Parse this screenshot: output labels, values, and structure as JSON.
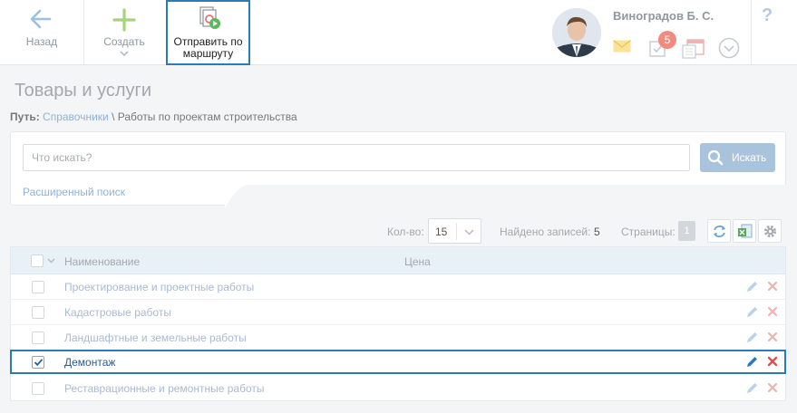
{
  "toolbar": {
    "back_label": "Назад",
    "create_label": "Создать",
    "route_label_line1": "Отправить по",
    "route_label_line2": "маршруту",
    "user_name": "Виноградов Б. С.",
    "tasks_badge": "5",
    "help_glyph": "?"
  },
  "page": {
    "title": "Товары и услуги",
    "path_label": "Путь:",
    "path_link": "Справочники",
    "path_rest": " \\ Работы по проектам строительства"
  },
  "search": {
    "placeholder": "Что искать?",
    "button_label": "Искать",
    "advanced_link": "Расширенный поиск"
  },
  "list_controls": {
    "qty_label": "Кол-во:",
    "qty_value": "15",
    "found_label": "Найдено записей:",
    "found_value": "5",
    "pages_label": "Страницы:",
    "pages_value": "1"
  },
  "table": {
    "columns": [
      "Наименование",
      "Цена"
    ],
    "rows": [
      {
        "name": "Проектирование и проектные работы",
        "checked": false
      },
      {
        "name": "Кадастровые работы",
        "checked": false
      },
      {
        "name": "Ландшафтные и земельные работы",
        "checked": false
      },
      {
        "name": "Демонтаж",
        "checked": true
      },
      {
        "name": "Реставрационные и ремонтные работы",
        "checked": false
      }
    ]
  },
  "colors": {
    "accent": "#2b7bbb",
    "link": "#8fb3d6",
    "delete": "#d9534f",
    "create_green": "#8bc34a"
  }
}
